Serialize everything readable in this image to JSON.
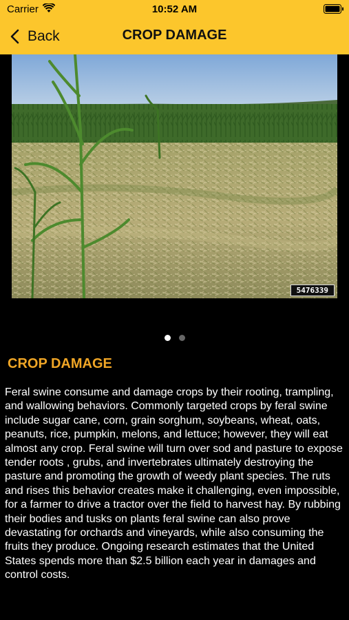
{
  "status_bar": {
    "carrier": "Carrier",
    "time": "10:52 AM"
  },
  "nav": {
    "back_label": "Back",
    "title": "CROP DAMAGE"
  },
  "carousel": {
    "photo_number": "5476339",
    "page_count": 2,
    "current_page": 1
  },
  "content": {
    "heading": "CROP DAMAGE",
    "body": "Feral swine consume and damage crops by their rooting, trampling, and wallowing behaviors. Commonly targeted crops by feral swine include sugar cane, corn, grain sorghum, soybeans, wheat, oats, peanuts, rice, pumpkin, melons, and lettuce; however, they will eat almost any crop. Feral swine will turn over sod and pasture to expose tender roots , grubs, and invertebrates ultimately destroying the pasture and promoting the growth of weedy plant species. The ruts and rises this behavior creates make it challenging, even impossible, for a farmer to drive a tractor over the field to harvest hay. By rubbing their bodies and tusks on plants feral swine can also prove devastating for orchards and vineyards, while also consuming the fruits they produce. Ongoing research estimates that the United States spends more than $2.5 billion each year in damages and control costs."
  },
  "colors": {
    "header_bg": "#fcc62c",
    "heading": "#f0a626",
    "page_bg": "#000000"
  },
  "icons": {
    "wifi": "wifi-icon",
    "battery": "battery-icon",
    "back": "chevron-left-icon"
  }
}
